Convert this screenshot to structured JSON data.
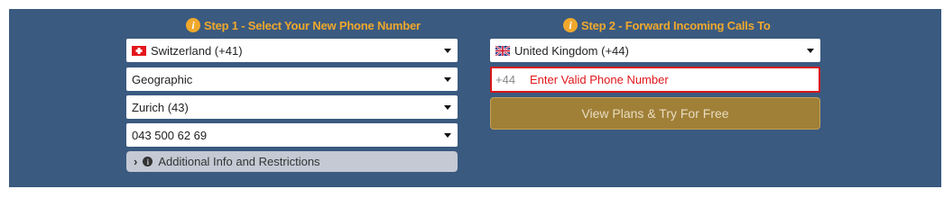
{
  "step1": {
    "title": "Step 1 - Select Your New Phone Number",
    "info_icon": "i",
    "country": "Switzerland (+41)",
    "number_type": "Geographic",
    "area": "Zurich (43)",
    "number": "043 500 62 69",
    "additional_info": "Additional Info and Restrictions"
  },
  "step2": {
    "title": "Step 2 - Forward Incoming Calls To",
    "info_icon": "i",
    "country": "United Kingdom (+44)",
    "prefix": "+44",
    "phone_placeholder": "Enter Valid Phone Number",
    "button_label": "View Plans & Try For Free"
  },
  "colors": {
    "panel_bg": "#3a5a80",
    "accent_orange": "#f0a82c",
    "error_red": "#d9161a",
    "button_gold": "#a07f37"
  }
}
